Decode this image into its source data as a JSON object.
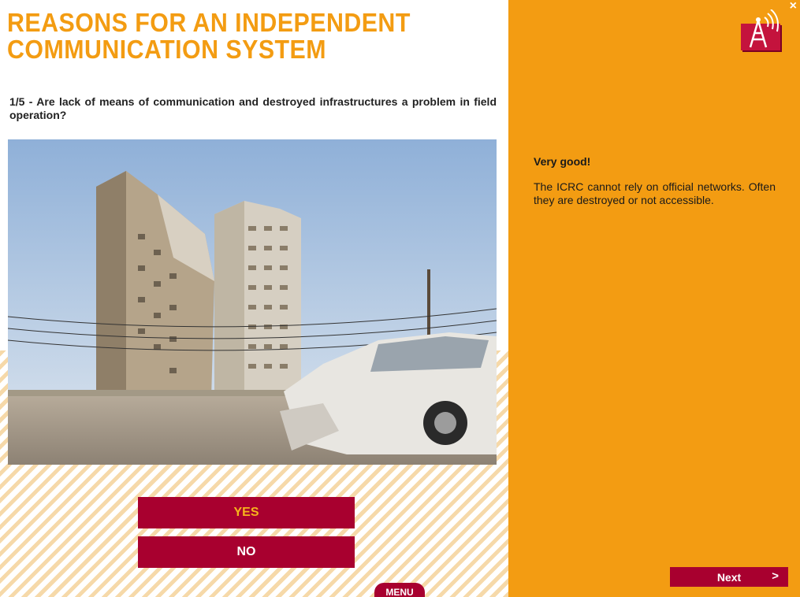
{
  "header": {
    "title_line1": "REASONS FOR AN INDEPENDENT",
    "title_line2": "COMMUNICATION SYSTEM"
  },
  "question": {
    "text": "1/5 - Are lack of means of communication and destroyed infrastructures a problem in field operation?"
  },
  "answers": {
    "yes_label": "YES",
    "no_label": "NO"
  },
  "nav": {
    "menu_label": "MENU",
    "next_label": "Next",
    "next_arrow": ">",
    "close_symbol": "×"
  },
  "feedback": {
    "title": "Very good!",
    "text": "The ICRC cannot rely on official networks. Often they are destroyed or not accessible."
  },
  "icons": {
    "logo": "radio-antenna-icon",
    "close": "close-icon"
  },
  "colors": {
    "accent_orange": "#f39c12",
    "button_red": "#a8002f",
    "yes_text": "#f6b51c"
  }
}
